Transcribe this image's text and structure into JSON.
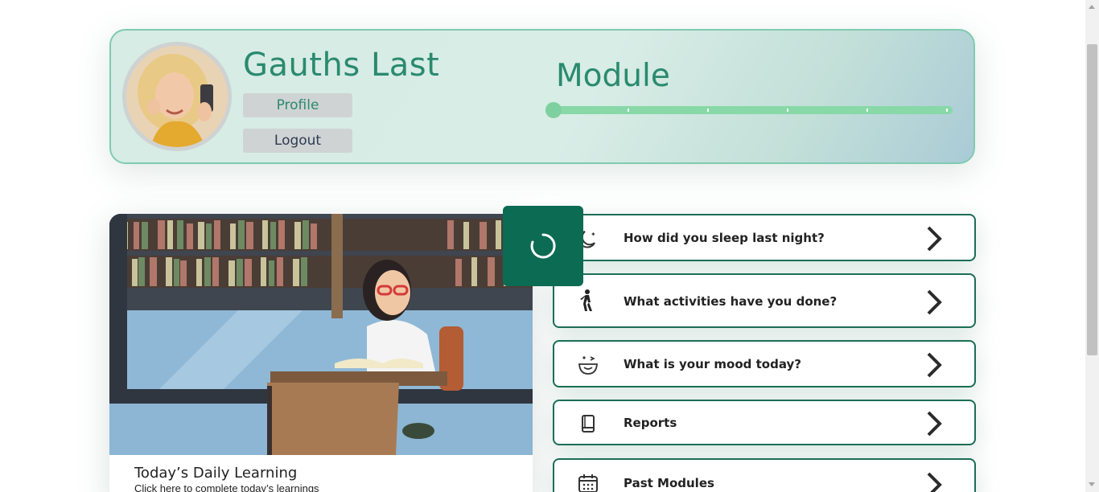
{
  "header": {
    "user_name": "Gauths Last",
    "profile_label": "Profile",
    "logout_label": "Logout",
    "module_title": "Module",
    "module_progress": 0.0,
    "module_steps": 5
  },
  "learning": {
    "title": "Today’s Daily Learning",
    "subtitle": "Click here to complete today’s learnings"
  },
  "menu": {
    "items": [
      {
        "label": "How did you sleep last night?",
        "icon": "sleep-moon-icon"
      },
      {
        "label": "What activities have you done?",
        "icon": "walking-person-icon"
      },
      {
        "label": "What is your mood today?",
        "icon": "mood-face-icon"
      },
      {
        "label": "Reports",
        "icon": "book-icon"
      },
      {
        "label": "Past Modules",
        "icon": "calendar-icon"
      }
    ]
  },
  "colors": {
    "brand_green": "#2a8a6e",
    "dark_green": "#0b6b53",
    "progress_green": "#88d8a8",
    "border_green": "#1b6e56"
  }
}
